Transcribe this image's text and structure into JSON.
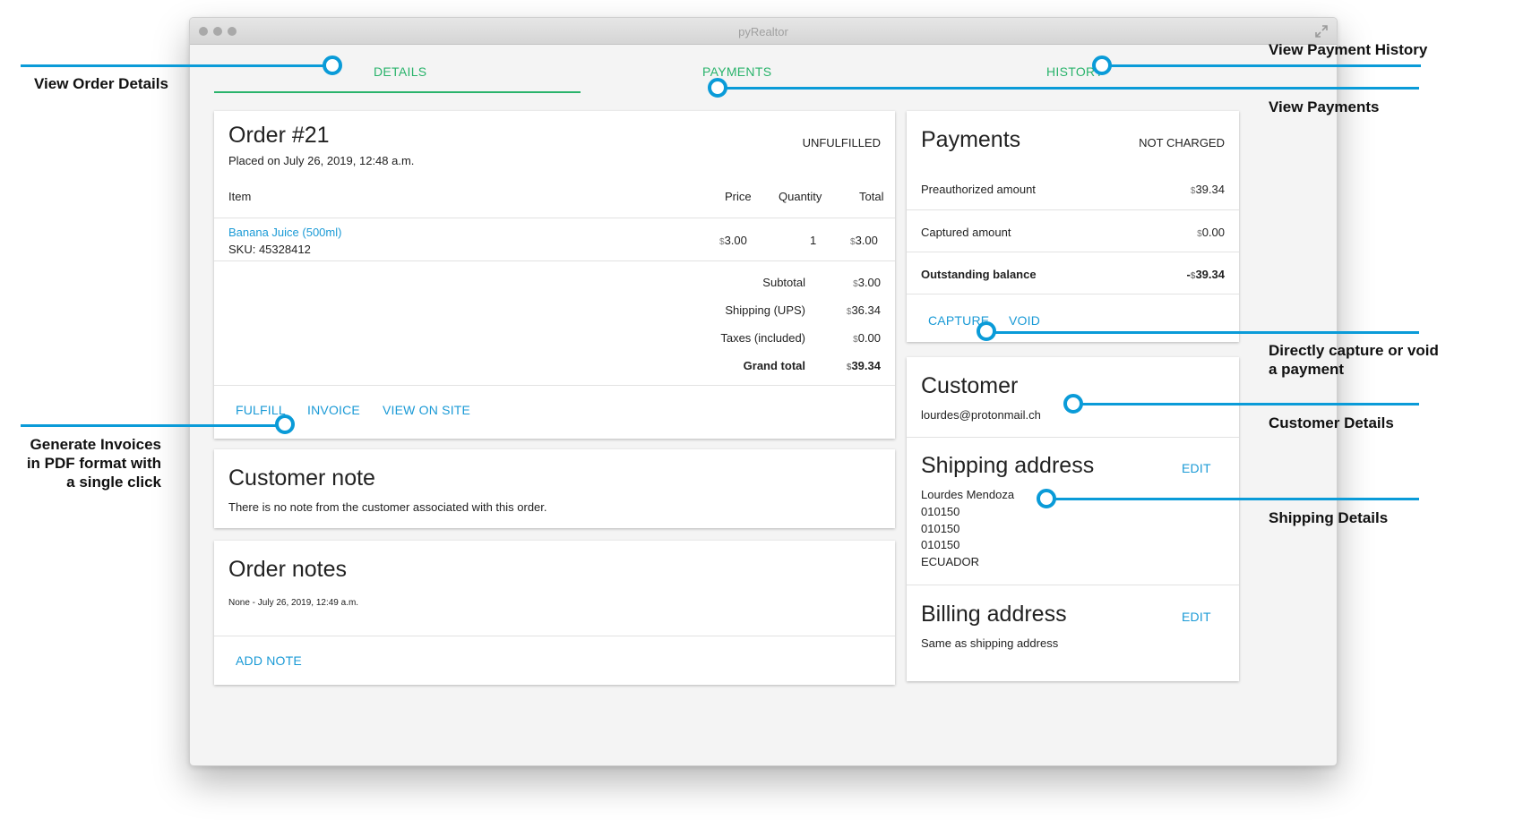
{
  "window": {
    "title": "pyRealtor"
  },
  "tabs": {
    "details": "DETAILS",
    "payments": "PAYMENTS",
    "history": "HISTORY"
  },
  "order": {
    "title": "Order #21",
    "status": "UNFULFILLED",
    "placed": "Placed on July 26, 2019, 12:48 a.m.",
    "columns": {
      "item": "Item",
      "price": "Price",
      "quantity": "Quantity",
      "total": "Total"
    },
    "line_item": {
      "name": "Banana Juice (500ml)",
      "sku": "SKU: 45328412",
      "currency": "$",
      "price": "3.00",
      "quantity": "1",
      "total": "3.00"
    },
    "summary": [
      {
        "label": "Subtotal",
        "currency": "$",
        "value": "3.00"
      },
      {
        "label": "Shipping (UPS)",
        "currency": "$",
        "value": "36.34"
      },
      {
        "label": "Taxes (included)",
        "currency": "$",
        "value": "0.00"
      },
      {
        "label": "Grand total",
        "currency": "$",
        "value": "39.34"
      }
    ],
    "actions": {
      "fulfill": "FULFILL",
      "invoice": "INVOICE",
      "view_on_site": "VIEW ON SITE"
    }
  },
  "customer_note": {
    "title": "Customer note",
    "text": "There is no note from the customer associated with this order."
  },
  "order_notes": {
    "title": "Order notes",
    "entry": "None - July 26, 2019, 12:49 a.m.",
    "add_note": "ADD NOTE"
  },
  "payments": {
    "title": "Payments",
    "status": "NOT CHARGED",
    "rows": [
      {
        "label": "Preauthorized amount",
        "prefix": "",
        "currency": "$",
        "value": "39.34"
      },
      {
        "label": "Captured amount",
        "prefix": "",
        "currency": "$",
        "value": "0.00"
      },
      {
        "label": "Outstanding balance",
        "prefix": "-",
        "currency": "$",
        "value": "39.34"
      }
    ],
    "actions": {
      "capture": "CAPTURE",
      "void": "VOID"
    }
  },
  "customer": {
    "title": "Customer",
    "email": "lourdes@protonmail.ch",
    "shipping": {
      "title": "Shipping address",
      "edit": "EDIT",
      "lines": [
        "Lourdes Mendoza",
        "010150",
        "010150",
        "010150",
        "ECUADOR"
      ]
    },
    "billing": {
      "title": "Billing address",
      "edit": "EDIT",
      "text": "Same as shipping address"
    }
  },
  "annotations": {
    "order_details": "View Order Details",
    "payment_history": "View Payment History",
    "payments": "View Payments",
    "capture_void": [
      "Directly capture or void",
      "a payment"
    ],
    "customer_details": "Customer Details",
    "shipping_details": "Shipping Details",
    "invoices": [
      "Generate Invoices",
      "in PDF format with",
      "a single click"
    ]
  },
  "colors": {
    "tab_green": "#29b36b",
    "link_blue": "#1a9ad6",
    "annotation_blue": "#0a9bd8"
  }
}
